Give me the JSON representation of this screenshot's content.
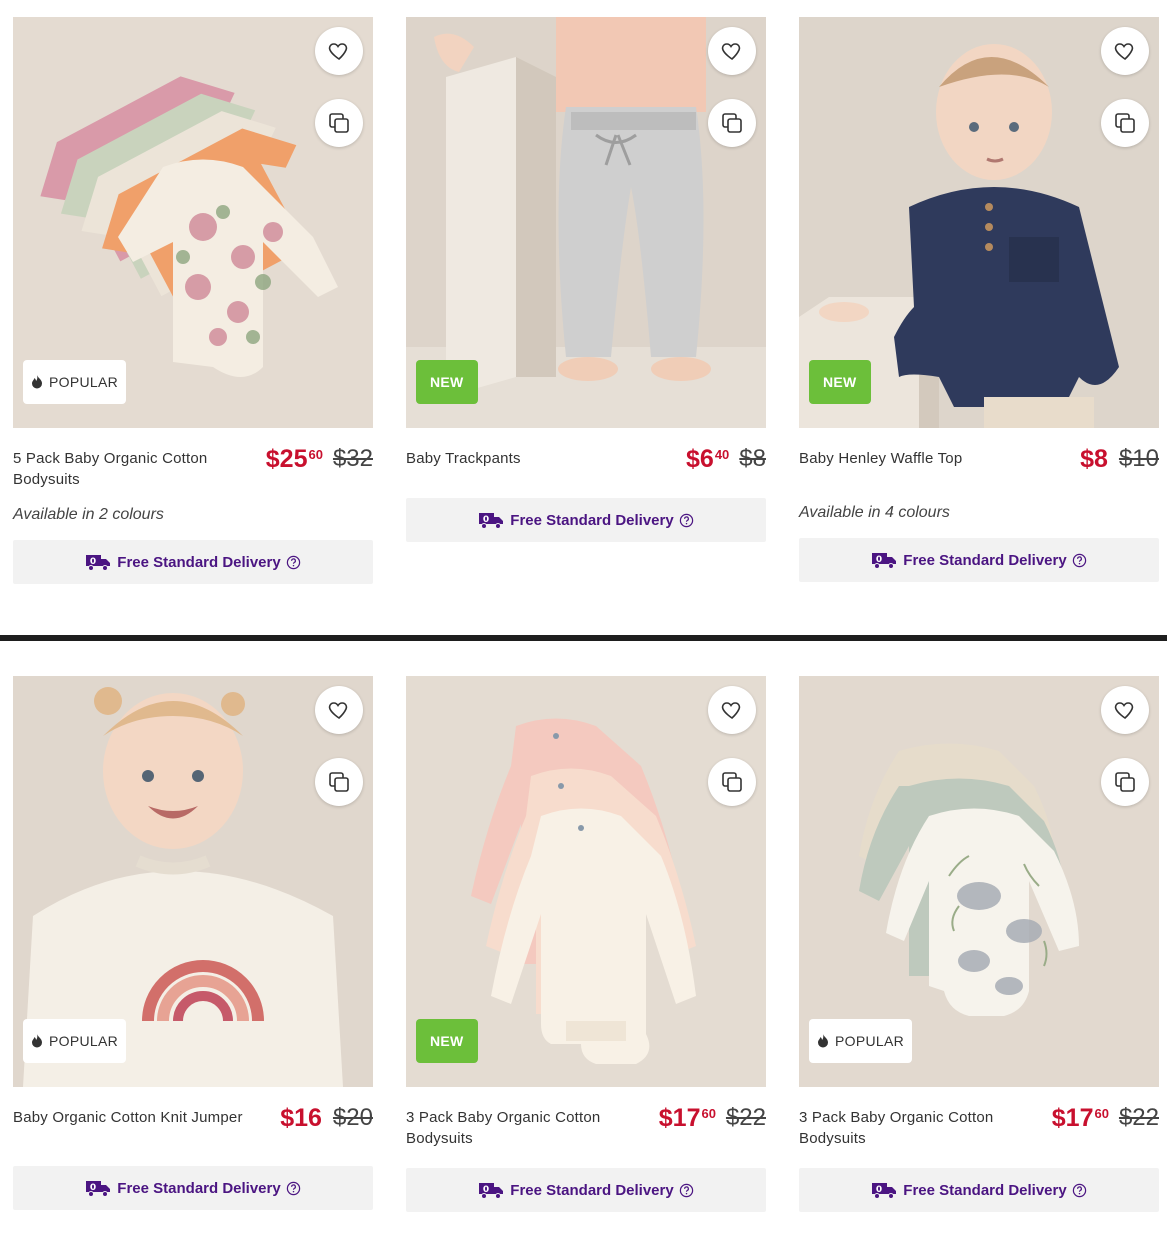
{
  "products": [
    {
      "title": "5 Pack Baby Organic Cotton Bodysuits",
      "price_whole": "$25",
      "price_cents": "60",
      "was": "$32",
      "badge": "POPULAR",
      "colours": "Available in 2 colours",
      "delivery": "Free Standard Delivery",
      "image": "five-bodysuits-floral"
    },
    {
      "title": "Baby Trackpants",
      "price_whole": "$6",
      "price_cents": "40",
      "was": "$8",
      "badge": "NEW",
      "colours": "",
      "delivery": "Free Standard Delivery",
      "image": "baby-grey-trackpants"
    },
    {
      "title": "Baby Henley Waffle Top",
      "price_whole": "$8",
      "price_cents": "",
      "was": "$10",
      "badge": "NEW",
      "colours": "Available in 4 colours",
      "delivery": "Free Standard Delivery",
      "image": "baby-navy-henley"
    },
    {
      "title": "Baby Organic Cotton Knit Jumper",
      "price_whole": "$16",
      "price_cents": "",
      "was": "$20",
      "badge": "POPULAR",
      "colours": "",
      "delivery": "Free Standard Delivery",
      "image": "girl-rainbow-jumper"
    },
    {
      "title": "3 Pack Baby Organic Cotton Bodysuits",
      "price_whole": "$17",
      "price_cents": "60",
      "was": "$22",
      "badge": "NEW",
      "colours": "",
      "delivery": "Free Standard Delivery",
      "image": "three-bodysuits-pink"
    },
    {
      "title": "3 Pack Baby Organic Cotton Bodysuits",
      "price_whole": "$17",
      "price_cents": "60",
      "was": "$22",
      "badge": "POPULAR",
      "colours": "",
      "delivery": "Free Standard Delivery",
      "image": "three-bodysuits-animals"
    }
  ],
  "icons": {
    "favourite": "heart-icon",
    "compare": "compare-icon",
    "popular": "flame-icon",
    "delivery": "delivery-truck-icon",
    "help": "help-circle-icon"
  },
  "colors": {
    "price": "#c8102e",
    "delivery_text": "#4b1582",
    "new_badge": "#6cbf3a",
    "delivery_bg": "#f2f2f2"
  }
}
